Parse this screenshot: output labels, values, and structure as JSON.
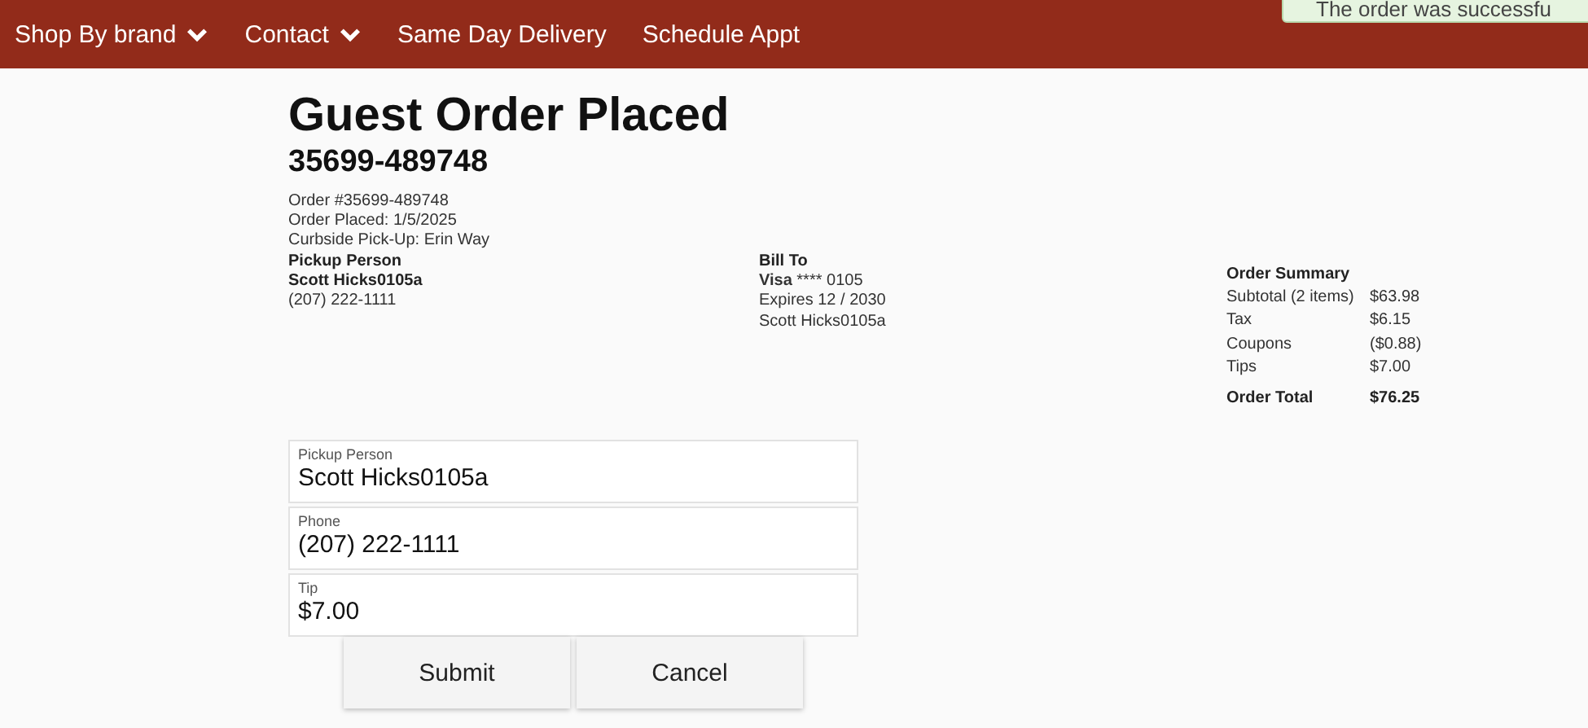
{
  "nav": {
    "items": [
      {
        "label": "Shop By brand",
        "dropdown": true
      },
      {
        "label": "Contact",
        "dropdown": true
      },
      {
        "label": "Same Day Delivery",
        "dropdown": false
      },
      {
        "label": "Schedule Appt",
        "dropdown": false
      }
    ]
  },
  "toast": {
    "text": "The order was successfu"
  },
  "title": "Guest Order Placed",
  "order_number": "35699-489748",
  "details": {
    "lines": [
      "Order #35699-489748",
      "Order Placed: 1/5/2025",
      "Curbside Pick-Up: Erin Way"
    ],
    "pickup_heading": "Pickup Person",
    "pickup_name": "Scott Hicks0105a",
    "pickup_phone": "(207) 222-1111"
  },
  "bill_to": {
    "heading": "Bill To",
    "card_brand": "Visa",
    "card_number": "**** 0105",
    "expires": "Expires 12 / 2030",
    "name": "Scott Hicks0105a"
  },
  "summary": {
    "heading": "Order Summary",
    "rows": [
      {
        "label": "Subtotal (2 items)",
        "value": "$63.98",
        "total": false
      },
      {
        "label": "Tax",
        "value": "$6.15",
        "total": false
      },
      {
        "label": "Coupons",
        "value": "($0.88)",
        "total": false
      },
      {
        "label": "Tips",
        "value": "$7.00",
        "total": false
      },
      {
        "label": "Order Total",
        "value": "$76.25",
        "total": true
      }
    ]
  },
  "fields": [
    {
      "label": "Pickup Person",
      "value": "Scott Hicks0105a"
    },
    {
      "label": "Phone",
      "value": "(207) 222-1111"
    },
    {
      "label": "Tip",
      "value": "$7.00"
    }
  ],
  "buttons": [
    "Submit",
    "Cancel"
  ]
}
